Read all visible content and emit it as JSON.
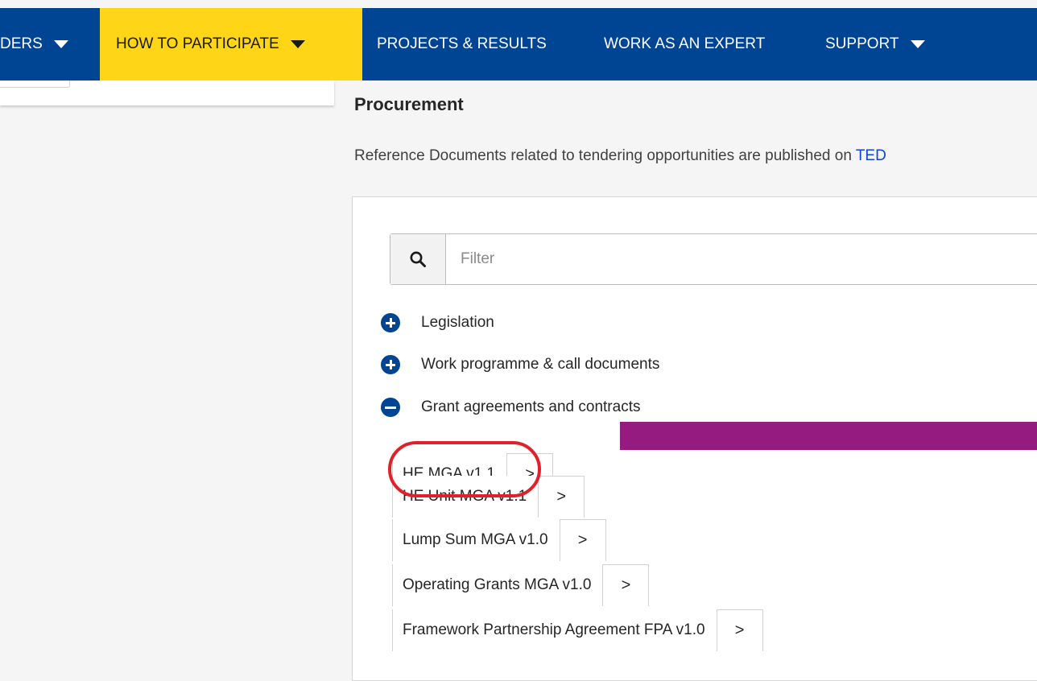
{
  "nav": {
    "items": [
      {
        "label": "DERS",
        "has_dropdown": true
      },
      {
        "label": "HOW TO PARTICIPATE",
        "has_dropdown": true,
        "active": true
      },
      {
        "label": "PROJECTS & RESULTS",
        "has_dropdown": false
      },
      {
        "label": "WORK AS AN EXPERT",
        "has_dropdown": false
      },
      {
        "label": "SUPPORT",
        "has_dropdown": true
      }
    ]
  },
  "page": {
    "title": "Procurement",
    "intro_text": "Reference Documents related to tendering opportunities are published on ",
    "intro_link": "TED"
  },
  "filter": {
    "placeholder": "Filter",
    "icon": "search-icon"
  },
  "tree": [
    {
      "label": "Legislation",
      "state": "collapsed",
      "icon": "plus-circle-icon"
    },
    {
      "label": "Work programme & call documents",
      "state": "collapsed",
      "icon": "plus-circle-icon"
    },
    {
      "label": "Grant agreements and contracts",
      "state": "expanded",
      "icon": "minus-circle-icon"
    }
  ],
  "documents": [
    {
      "label": "HE MGA v1.1",
      "action": ">"
    },
    {
      "label": "HE Unit MGA v1.1",
      "action": ">"
    },
    {
      "label": "Lump Sum MGA v1.0",
      "action": ">"
    },
    {
      "label": "Operating Grants MGA v1.0",
      "action": ">"
    },
    {
      "label": "Framework Partnership Agreement FPA v1.0",
      "action": ">"
    }
  ],
  "colors": {
    "nav_bg": "#004494",
    "nav_active_bg": "#ffd617",
    "link": "#0e47cb",
    "highlight_bar": "#951b81",
    "annotation_ring": "#e0202b"
  }
}
